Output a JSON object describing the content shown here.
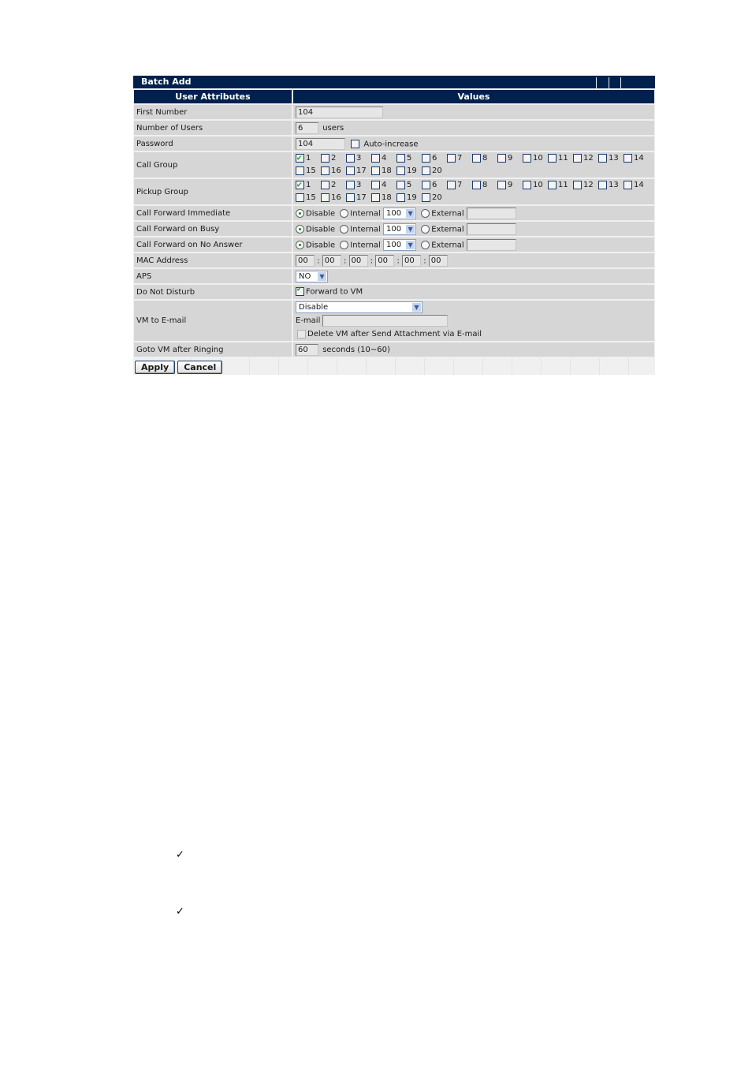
{
  "window": {
    "title": "Batch Add"
  },
  "table": {
    "headers": [
      "User Attributes",
      "Values"
    ],
    "first_number": {
      "label": "First Number",
      "value": "104"
    },
    "number_of_users": {
      "label": "Number of Users",
      "value": "6",
      "unit": "users"
    },
    "password": {
      "label": "Password",
      "value": "104",
      "auto_increase_label": "Auto-increase",
      "auto_increase_checked": false
    },
    "call_group": {
      "label": "Call Group",
      "options": [
        "1",
        "2",
        "3",
        "4",
        "5",
        "6",
        "7",
        "8",
        "9",
        "10",
        "11",
        "12",
        "13",
        "14",
        "15",
        "16",
        "17",
        "18",
        "19",
        "20"
      ],
      "checked": [
        "1"
      ]
    },
    "pickup_group": {
      "label": "Pickup Group",
      "options": [
        "1",
        "2",
        "3",
        "4",
        "5",
        "6",
        "7",
        "8",
        "9",
        "10",
        "11",
        "12",
        "13",
        "14",
        "15",
        "16",
        "17",
        "18",
        "19",
        "20"
      ],
      "checked": [
        "1"
      ]
    },
    "call_forward": [
      {
        "label": "Call Forward Immediate",
        "disable": "Disable",
        "internal": "Internal",
        "internal_value": "100",
        "external": "External",
        "external_value": "",
        "selected": "Disable"
      },
      {
        "label": "Call Forward on Busy",
        "disable": "Disable",
        "internal": "Internal",
        "internal_value": "100",
        "external": "External",
        "external_value": "",
        "selected": "Disable"
      },
      {
        "label": "Call Forward on No Answer",
        "disable": "Disable",
        "internal": "Internal",
        "internal_value": "100",
        "external": "External",
        "external_value": "",
        "selected": "Disable"
      }
    ],
    "mac_address": {
      "label": "MAC Address",
      "octets": [
        "00",
        "00",
        "00",
        "00",
        "00",
        "00"
      ],
      "separator": ":"
    },
    "aps": {
      "label": "APS",
      "value": "NO"
    },
    "do_not_disturb": {
      "label": "Do Not Disturb",
      "option_label": "Forward to VM",
      "checked": true
    },
    "vm_to_email": {
      "label": "VM to E-mail",
      "select_value": "Disable",
      "email_label": "E-mail",
      "email_value": "",
      "delete_label": "Delete VM after Send Attachment via E-mail",
      "delete_checked": false
    },
    "goto_vm": {
      "label": "Goto VM after Ringing",
      "value": "60",
      "unit": "seconds (10~60)"
    }
  },
  "buttons": {
    "apply": "Apply",
    "cancel": "Cancel"
  },
  "notes": {
    "check1": "✓",
    "check2": "✓"
  },
  "colors": {
    "header_bg": "#00214d",
    "row_bg": "#d6d6d6",
    "check_green": "#1e9a1e"
  }
}
